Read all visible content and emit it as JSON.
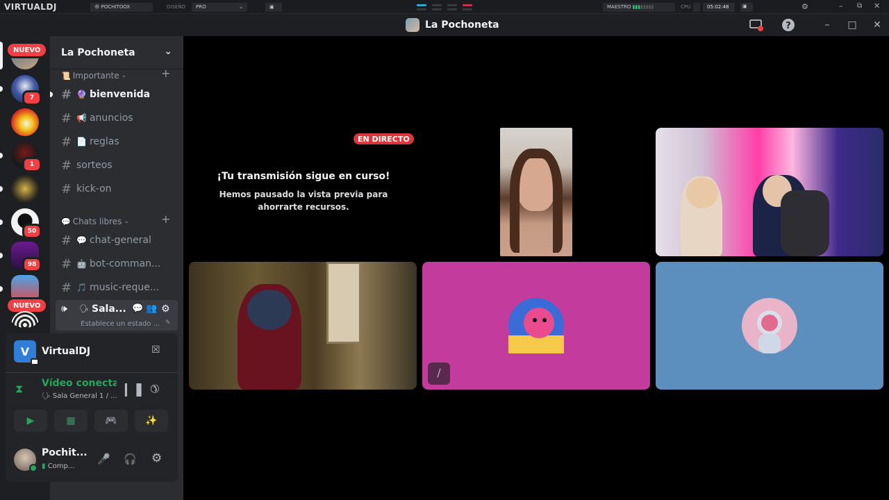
{
  "vdj": {
    "logo": "VIRTUALDJ",
    "user": "POCHITOOX",
    "design_label": "DISEÑO",
    "design_value": "PRO",
    "master_label": "MAESTRO",
    "cpu_label": "CPU",
    "clock": "05:02:48"
  },
  "window": {
    "title": "La Pochoneta"
  },
  "servers": {
    "new_badge": "NUEVO",
    "badges": [
      "7",
      "1",
      "50",
      "98"
    ]
  },
  "guild": {
    "name": "La Pochoneta",
    "categories": [
      {
        "label": "Importante"
      },
      {
        "label": "Chats libres"
      }
    ],
    "channels": [
      {
        "name": "bienvenida",
        "emoji": "🔮"
      },
      {
        "name": "anuncios",
        "emoji": "📢"
      },
      {
        "name": "reglas",
        "emoji": "📄"
      },
      {
        "name": "sorteos",
        "emoji": ""
      },
      {
        "name": "kick-on",
        "emoji": ""
      },
      {
        "name": "chat-general",
        "emoji": "💬"
      },
      {
        "name": "bot-comman...",
        "emoji": "🤖"
      },
      {
        "name": "music-reque...",
        "emoji": "🎵"
      }
    ],
    "voice": {
      "name": "Sala...",
      "status": "Establece un estado ..."
    }
  },
  "panel": {
    "app_name": "VirtualDJ",
    "connection_status": "Vídeo conectad",
    "connection_channel": "Sala General 1 / ...",
    "user_name": "Pochit...",
    "user_status": "Comp..."
  },
  "stream": {
    "live_badge": "EN DIRECTO",
    "paused_title": "¡Tu transmisión sigue en curso!",
    "paused_text": "Hemos pausado la vista previa para ahorrarte recursos."
  },
  "colors": {
    "accent_green": "#23a55a",
    "tile_pink": "#c33b9d",
    "tile_blue": "#5c8fbd",
    "live_red": "#da373c"
  }
}
